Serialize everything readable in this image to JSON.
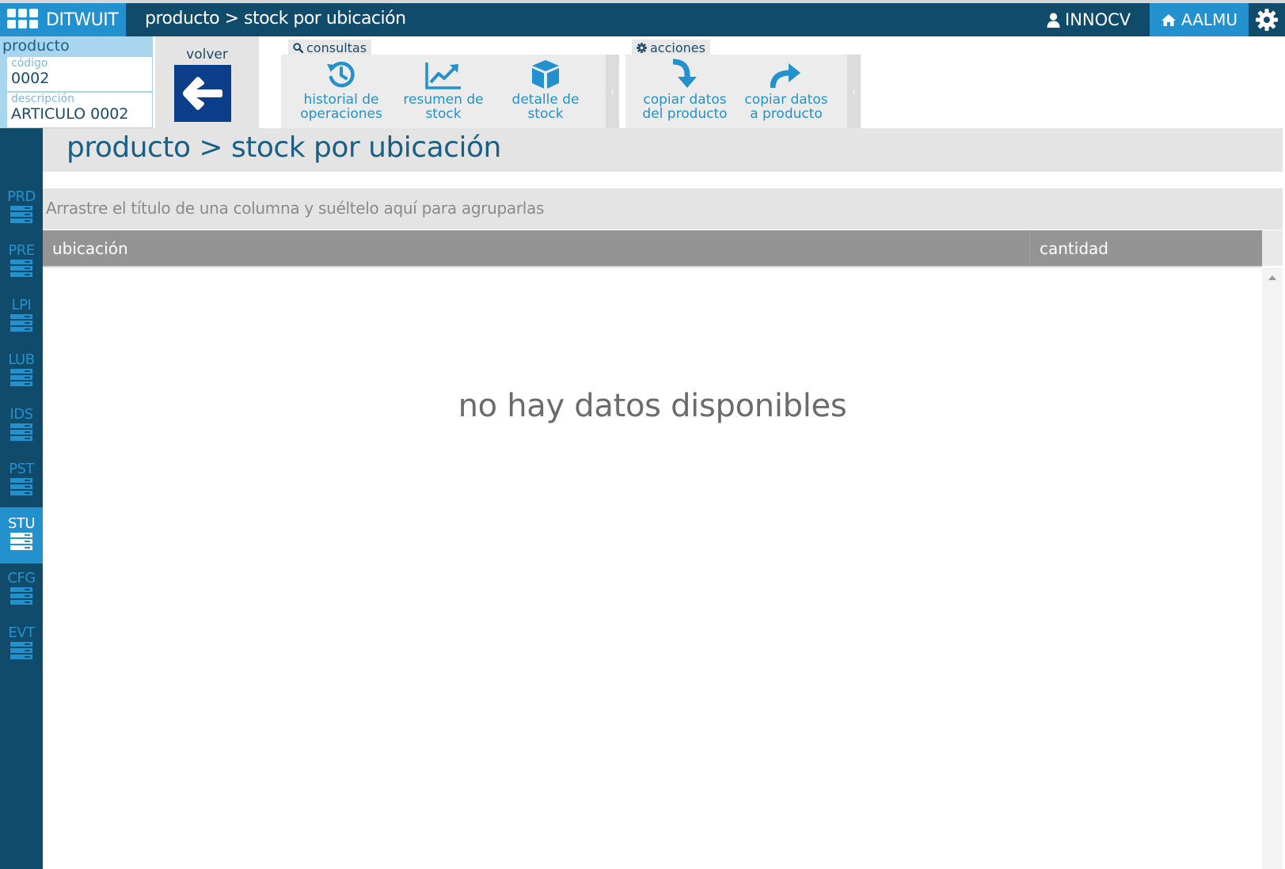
{
  "app": {
    "brand": "DITWUIT",
    "title": "producto > stock por ubicación",
    "user": "INNOCV",
    "warehouse": "AALMU"
  },
  "product": {
    "heading": "producto",
    "code_label": "código",
    "code_value": "0002",
    "desc_label": "descripción",
    "desc_value": "ARTICULO 0002"
  },
  "back": {
    "label": "volver"
  },
  "consultas": {
    "label": "consultas",
    "buttons": [
      {
        "label": "historial de\noperaciones",
        "icon": "history-icon"
      },
      {
        "label": "resumen de\nstock",
        "icon": "chart-line-icon"
      },
      {
        "label": "detalle de\nstock",
        "icon": "cube-icon"
      }
    ]
  },
  "acciones": {
    "label": "acciones",
    "buttons": [
      {
        "label": "copiar datos\ndel producto",
        "icon": "arrow-down-curved-icon"
      },
      {
        "label": "copiar datos\na producto",
        "icon": "share-icon"
      }
    ]
  },
  "nav": {
    "items": [
      {
        "label": "PRD"
      },
      {
        "label": "PRE"
      },
      {
        "label": "LPI"
      },
      {
        "label": "LUB"
      },
      {
        "label": "IDS"
      },
      {
        "label": "PST"
      },
      {
        "label": "STU",
        "active": true
      },
      {
        "label": "CFG"
      },
      {
        "label": "EVT"
      }
    ]
  },
  "page": {
    "heading": "producto > stock por ubicación",
    "group_hint": "Arrastre el título de una columna y suéltelo aquí para agruparlas",
    "columns": [
      "ubicación",
      "cantidad"
    ],
    "empty_text": "no hay datos disponibles"
  },
  "colors": {
    "topbar": "#104b6b",
    "accent": "#2491cf"
  }
}
